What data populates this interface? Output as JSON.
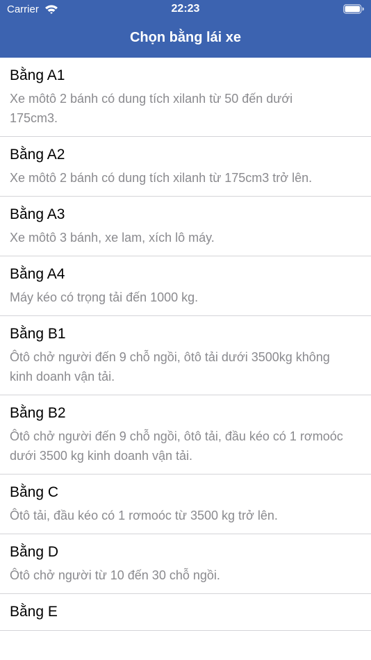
{
  "status_bar": {
    "carrier": "Carrier",
    "time": "22:23",
    "icons": [
      "wifi-icon",
      "battery-icon"
    ]
  },
  "nav": {
    "title": "Chọn bằng lái xe"
  },
  "colors": {
    "nav_background": "#3c63b0",
    "title_text": "#000000",
    "description_text": "#8a8a8e",
    "separator": "#d4d4d8"
  },
  "licenses": [
    {
      "title": "Bằng A1",
      "description": "Xe môtô 2 bánh có dung tích xilanh từ 50 đến dưới 175cm3."
    },
    {
      "title": "Bằng A2",
      "description": "Xe môtô 2 bánh có dung tích xilanh từ 175cm3 trở lên."
    },
    {
      "title": "Bằng A3",
      "description": "Xe môtô 3 bánh, xe lam, xích lô máy."
    },
    {
      "title": "Bằng A4",
      "description": "Máy kéo có trọng tải đến 1000 kg."
    },
    {
      "title": "Bằng B1",
      "description": "Ôtô chở người đến 9 chỗ ngồi, ôtô tải dưới 3500kg không kinh doanh vận tải."
    },
    {
      "title": "Bằng B2",
      "description": "Ôtô chở người đến 9 chỗ ngồi, ôtô tải, đầu kéo có 1 rơmoóc dưới 3500 kg kinh doanh vận tải."
    },
    {
      "title": "Bằng C",
      "description": "Ôtô tải, đầu kéo có 1 rơmoóc từ 3500 kg trở lên."
    },
    {
      "title": "Bằng D",
      "description": "Ôtô chở người từ 10 đến 30 chỗ ngồi."
    },
    {
      "title": "Bằng E",
      "description": ""
    }
  ]
}
